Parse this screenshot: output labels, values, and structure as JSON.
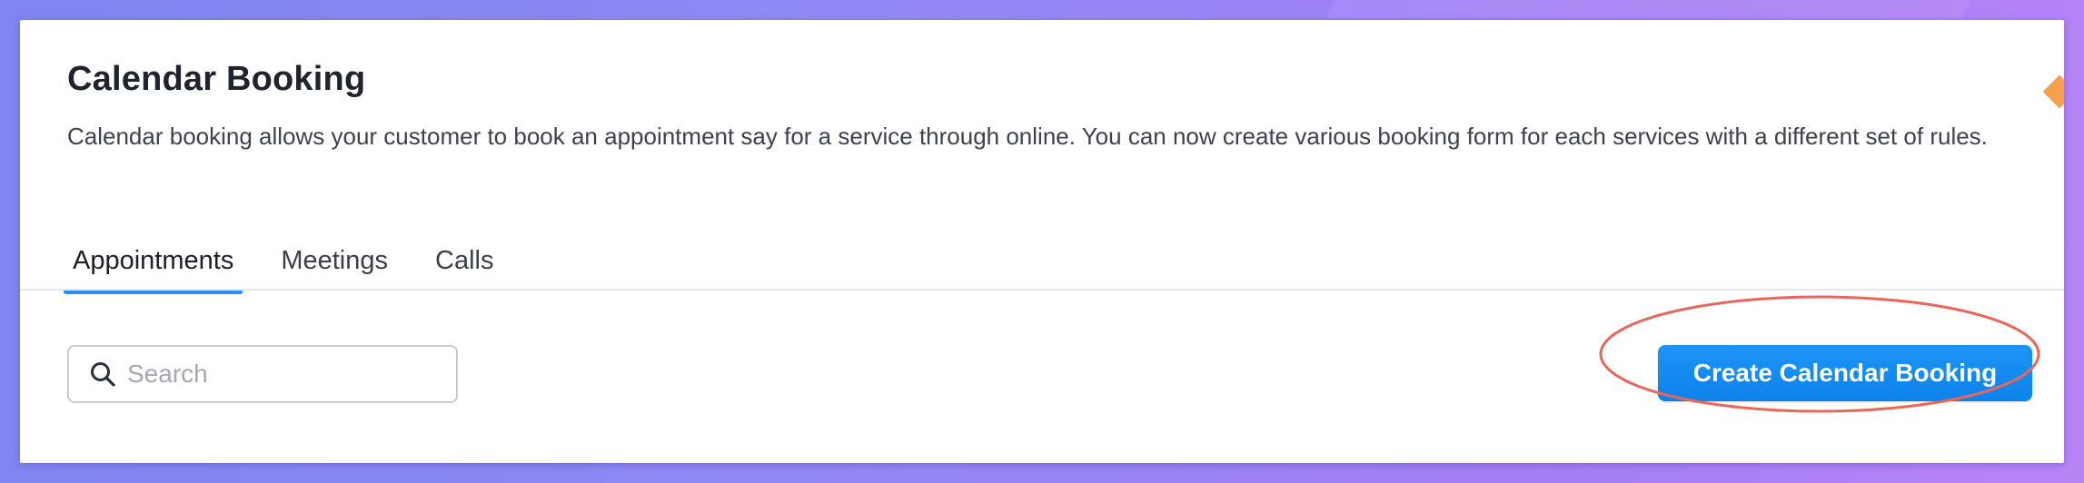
{
  "page": {
    "title": "Calendar Booking",
    "description": "Calendar booking allows your customer to book an appointment say for a service through online. You can now create various booking form for each services with a different set of rules."
  },
  "tabs": [
    {
      "label": "Appointments",
      "active": true
    },
    {
      "label": "Meetings",
      "active": false
    },
    {
      "label": "Calls",
      "active": false
    }
  ],
  "search": {
    "placeholder": "Search",
    "value": ""
  },
  "actions": {
    "create_label": "Create Calendar Booking"
  },
  "colors": {
    "accent": "#2b8ef0",
    "button": "#0c82eb",
    "highlight": "#e8665a",
    "marker": "#f6a04d"
  },
  "icons": {
    "search": "search-icon"
  }
}
